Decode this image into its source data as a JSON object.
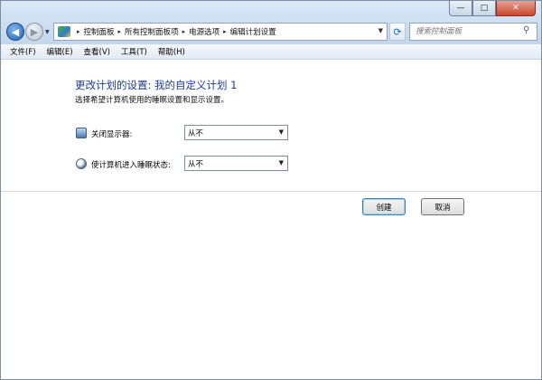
{
  "window": {
    "caption": {
      "minimize_glyph": "—",
      "maximize_glyph": "□",
      "close_glyph": "✕"
    }
  },
  "nav": {
    "back_glyph": "◀",
    "forward_glyph": "▶",
    "dropdown_glyph": "▼",
    "refresh_glyph": "⟳"
  },
  "address": {
    "breadcrumbs": [
      "控制面板",
      "所有控制面板项",
      "电源选项",
      "编辑计划设置"
    ],
    "separator": "▸"
  },
  "search": {
    "placeholder": "搜索控制面板",
    "icon": "search-icon"
  },
  "menu": [
    "文件(F)",
    "编辑(E)",
    "查看(V)",
    "工具(T)",
    "帮助(H)"
  ],
  "main": {
    "title": "更改计划的设置: 我的自定义计划 1",
    "description": "选择希望计算机使用的睡眠设置和显示设置。",
    "settings": [
      {
        "label": "关闭显示器:",
        "value": "从不",
        "icon": "monitor-icon"
      },
      {
        "label": "使计算机进入睡眠状态:",
        "value": "从不",
        "icon": "moon-icon"
      }
    ],
    "buttons": {
      "create": "创建",
      "cancel": "取消"
    }
  }
}
